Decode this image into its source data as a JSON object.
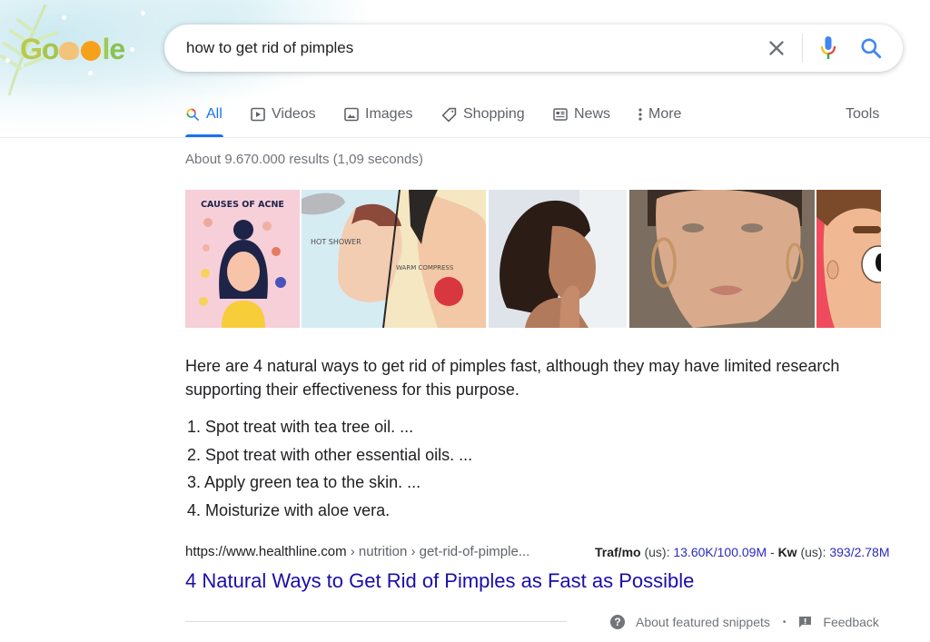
{
  "header": {
    "logo_alt": "Google"
  },
  "search": {
    "query": "how to get rid of pimples",
    "clear_icon": "close-icon",
    "mic_icon": "microphone-icon",
    "search_icon": "search-icon"
  },
  "tabs": [
    {
      "label": "All",
      "icon": "search-icon",
      "active": true
    },
    {
      "label": "Videos",
      "icon": "play-icon",
      "active": false
    },
    {
      "label": "Images",
      "icon": "image-icon",
      "active": false
    },
    {
      "label": "Shopping",
      "icon": "tag-icon",
      "active": false
    },
    {
      "label": "News",
      "icon": "newspaper-icon",
      "active": false
    },
    {
      "label": "More",
      "icon": "more-vert-icon",
      "active": false
    }
  ],
  "tools_label": "Tools",
  "result_stats": "About 9.670.000 results (1,09 seconds)",
  "images": [
    {
      "name": "causes-of-acne",
      "caption": "CAUSES OF ACNE"
    },
    {
      "name": "hot-shower-warm-compress",
      "labels": [
        "HOT SHOWER",
        "WARM COMPRESS"
      ]
    },
    {
      "name": "woman-touching-chin"
    },
    {
      "name": "woman-hoop-earrings"
    },
    {
      "name": "cartoon-face"
    }
  ],
  "snippet": {
    "intro": "Here are 4 natural ways to get rid of pimples fast, although they may have limited research supporting their effectiveness for this purpose.",
    "items": [
      "1. Spot treat with tea tree oil. ...",
      "2. Spot treat with other essential oils. ...",
      "3. Apply green tea to the skin. ...",
      "4. Moisturize with aloe vera."
    ]
  },
  "result": {
    "domain": "https://www.healthline.com",
    "breadcrumb": " › nutrition › get-rid-of-pimple...",
    "title": "4 Natural Ways to Get Rid of Pimples as Fast as Possible"
  },
  "seo_metrics": {
    "traf_label": "Traf/mo",
    "traf_region": " (us): ",
    "traf_value": "13.60K/100.09M",
    "separator": " - ",
    "kw_label": "Kw",
    "kw_region": " (us): ",
    "kw_value": "393/2.78M"
  },
  "footer": {
    "about_label": "About featured snippets",
    "dot": "•",
    "feedback_label": "Feedback"
  }
}
